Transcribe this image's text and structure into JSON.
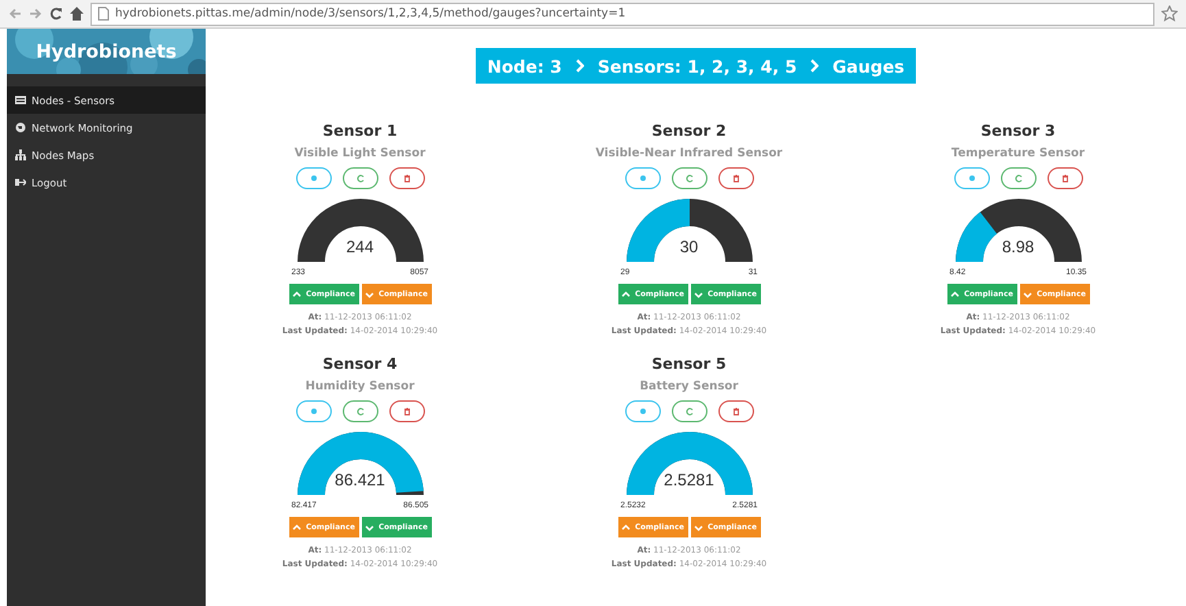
{
  "browser": {
    "url": "hydrobionets.pittas.me/admin/node/3/sensors/1,2,3,4,5/method/gauges?uncertainty=1"
  },
  "sidebar": {
    "title": "Hydrobionets",
    "items": [
      {
        "label": "Nodes - Sensors",
        "selected": true
      },
      {
        "label": "Network Monitoring",
        "selected": false
      },
      {
        "label": "Nodes Maps",
        "selected": false
      },
      {
        "label": "Logout",
        "selected": false
      }
    ]
  },
  "breadcrumb": [
    "Node: 3",
    "Sensors: 1, 2, 3, 4, 5",
    "Gauges"
  ],
  "sensors": [
    {
      "title": "Sensor 1",
      "type": "Visible Light Sensor",
      "value": "244",
      "min": "233",
      "max": "8057",
      "compliance": [
        {
          "kind": "up",
          "label": "Compliance",
          "pass": true
        },
        {
          "kind": "down",
          "label": "Compliance",
          "pass": false
        }
      ],
      "at_label": "At:",
      "at": "11-12-2013 06:11:02",
      "updated_label": "Last Updated:",
      "updated": "14-02-2014 10:29:40"
    },
    {
      "title": "Sensor 2",
      "type": "Visible-Near Infrared Sensor",
      "value": "30",
      "min": "29",
      "max": "31",
      "compliance": [
        {
          "kind": "up",
          "label": "Compliance",
          "pass": true
        },
        {
          "kind": "down",
          "label": "Compliance",
          "pass": true
        }
      ],
      "at_label": "At:",
      "at": "11-12-2013 06:11:02",
      "updated_label": "Last Updated:",
      "updated": "14-02-2014 10:29:40"
    },
    {
      "title": "Sensor 3",
      "type": "Temperature Sensor",
      "value": "8.98",
      "min": "8.42",
      "max": "10.35",
      "compliance": [
        {
          "kind": "up",
          "label": "Compliance",
          "pass": true
        },
        {
          "kind": "down",
          "label": "Compliance",
          "pass": false
        }
      ],
      "at_label": "At:",
      "at": "11-12-2013 06:11:02",
      "updated_label": "Last Updated:",
      "updated": "14-02-2014 10:29:40"
    },
    {
      "title": "Sensor 4",
      "type": "Humidity Sensor",
      "value": "86.421",
      "min": "82.417",
      "max": "86.505",
      "compliance": [
        {
          "kind": "up",
          "label": "Compliance",
          "pass": false
        },
        {
          "kind": "down",
          "label": "Compliance",
          "pass": true
        }
      ],
      "at_label": "At:",
      "at": "11-12-2013 06:11:02",
      "updated_label": "Last Updated:",
      "updated": "14-02-2014 10:29:40"
    },
    {
      "title": "Sensor 5",
      "type": "Battery Sensor",
      "value": "2.5281",
      "min": "2.5232",
      "max": "2.5281",
      "compliance": [
        {
          "kind": "up",
          "label": "Compliance",
          "pass": false
        },
        {
          "kind": "down",
          "label": "Compliance",
          "pass": false
        }
      ],
      "at_label": "At:",
      "at": "11-12-2013 06:11:02",
      "updated_label": "Last Updated:",
      "updated": "14-02-2014 10:29:40"
    }
  ]
}
